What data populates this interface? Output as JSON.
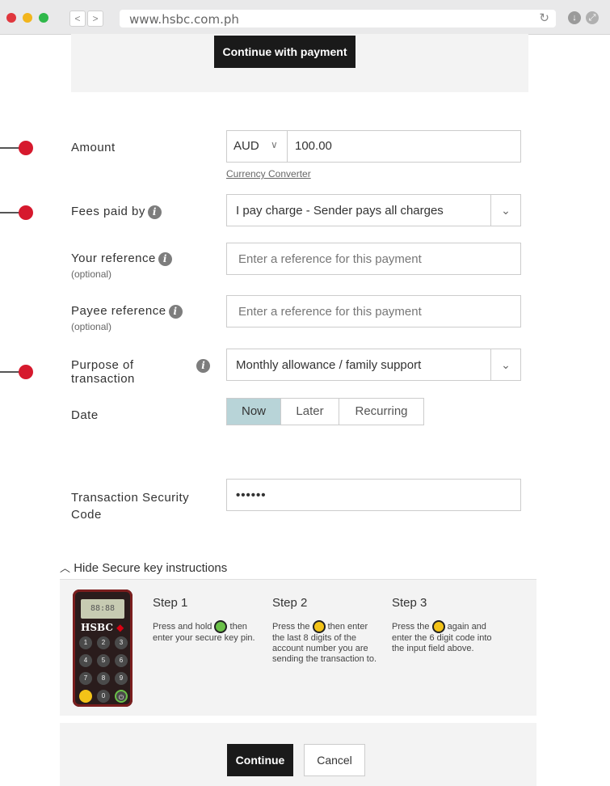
{
  "browser": {
    "url": "www.hsbc.com.ph",
    "back": "<",
    "forward": ">"
  },
  "top": {
    "continue_with_payment": "Continue with payment"
  },
  "form": {
    "amount": {
      "label": "Amount",
      "currency": "AUD",
      "value": "100.00",
      "link": "Currency Converter"
    },
    "fees": {
      "label": "Fees paid by",
      "value": "I pay charge - Sender pays all charges"
    },
    "your_reference": {
      "label": "Your reference",
      "optional": "(optional)",
      "placeholder": "Enter a reference for this payment"
    },
    "payee_reference": {
      "label": "Payee reference",
      "optional": "(optional)",
      "placeholder": "Enter a reference for this payment"
    },
    "purpose": {
      "label_line1": "Purpose of",
      "label_line2": "transaction",
      "value": "Monthly allowance / family support"
    },
    "date": {
      "label": "Date",
      "options": [
        "Now",
        "Later",
        "Recurring"
      ],
      "selected": "Now"
    },
    "security": {
      "label_line1": "Transaction Security",
      "label_line2": "Code",
      "value": "••••••"
    }
  },
  "secure_key": {
    "toggle": "Hide Secure key instructions",
    "device": {
      "screen": "88:88",
      "brand": "HSBC"
    },
    "steps": [
      {
        "title": "Step 1",
        "pre": "Press and hold",
        "post": "then enter your secure key pin."
      },
      {
        "title": "Step 2",
        "pre": "Press the",
        "post": "then enter the last 8 digits of the account number you are sending the transaction to."
      },
      {
        "title": "Step 3",
        "pre": "Press the",
        "post": "again and enter the 6 digit code into the input field above."
      }
    ]
  },
  "footer": {
    "continue": "Continue",
    "cancel": "Cancel"
  },
  "colors": {
    "marker": "#d6192d",
    "active_segment": "#b8d4d8",
    "dark_button": "#1a1a1a"
  }
}
